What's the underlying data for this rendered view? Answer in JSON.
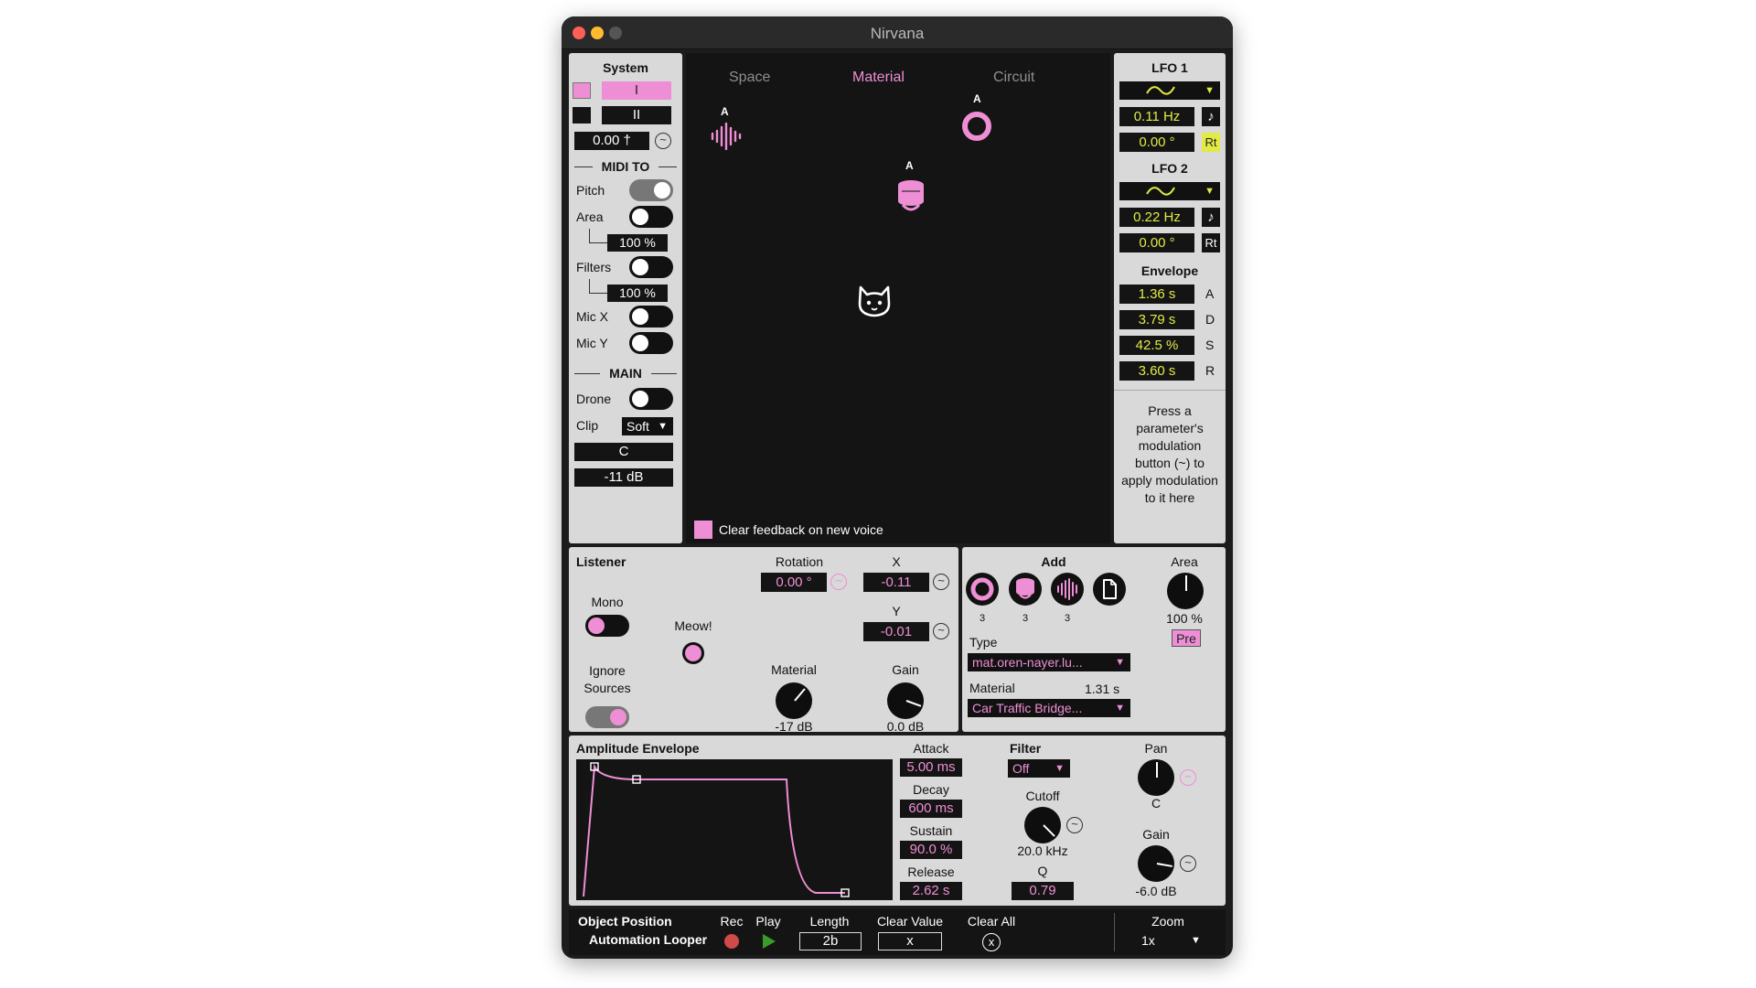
{
  "window": {
    "title": "Nirvana"
  },
  "system": {
    "title": "System",
    "play_symbol": "I",
    "pause_symbol": "II",
    "tempo_value": "0.00 †",
    "midi_to_heading": "MIDI TO",
    "pitch_label": "Pitch",
    "area_label": "Area",
    "area_value": "100 %",
    "filters_label": "Filters",
    "filters_value": "100 %",
    "mic_x_label": "Mic X",
    "mic_y_label": "Mic Y",
    "main_heading": "MAIN",
    "drone_label": "Drone",
    "clip_label": "Clip",
    "clip_value": "Soft",
    "key_value": "C",
    "level_value": "-11 dB"
  },
  "space": {
    "tabs": [
      "Space",
      "Material",
      "Circuit"
    ],
    "active_tab": "Material",
    "objects": [
      {
        "name": "waveform-source",
        "label": "A"
      },
      {
        "name": "ring-source",
        "label": "A"
      },
      {
        "name": "bell-source",
        "label": "A"
      }
    ],
    "clear_feedback_label": "Clear feedback on new voice"
  },
  "lfo1": {
    "title": "LFO 1",
    "rate": "0.11 Hz",
    "phase": "0.00 °",
    "sync_symbol": "♪",
    "rt_label": "Rt"
  },
  "lfo2": {
    "title": "LFO 2",
    "rate": "0.22 Hz",
    "phase": "0.00 °",
    "sync_symbol": "♪",
    "rt_label": "Rt"
  },
  "envelope": {
    "title": "Envelope",
    "rows": [
      {
        "value": "1.36 s",
        "letter": "A"
      },
      {
        "value": "3.79 s",
        "letter": "D"
      },
      {
        "value": "42.5 %",
        "letter": "S"
      },
      {
        "value": "3.60 s",
        "letter": "R"
      }
    ]
  },
  "help_text": "Press a parameter's modulation button (~) to apply modulation to it here",
  "listener": {
    "title": "Listener",
    "mono_label": "Mono",
    "meow_label": "Meow!",
    "ignore_sources_label": "Ignore Sources",
    "rotation_label": "Rotation",
    "rotation_value": "0.00 °",
    "x_label": "X",
    "x_value": "-0.11",
    "y_label": "Y",
    "y_value": "-0.01",
    "material_label": "Material",
    "material_value": "-17 dB",
    "gain_label": "Gain",
    "gain_value": "0.0 dB"
  },
  "add": {
    "title": "Add",
    "counts": [
      "3",
      "3",
      "3"
    ],
    "area_label": "Area",
    "area_value": "100 %",
    "pre_label": "Pre",
    "type_label": "Type",
    "type_value": "mat.oren-nayer.lu...",
    "material_label": "Material",
    "material_time": "1.31 s",
    "material_value": "Car Traffic Bridge..."
  },
  "amp_env": {
    "title": "Amplitude Envelope",
    "attack_label": "Attack",
    "attack_value": "5.00 ms",
    "decay_label": "Decay",
    "decay_value": "600 ms",
    "sustain_label": "Sustain",
    "sustain_value": "90.0 %",
    "release_label": "Release",
    "release_value": "2.62 s",
    "filter_label": "Filter",
    "filter_value": "Off",
    "cutoff_label": "Cutoff",
    "cutoff_value": "20.0 kHz",
    "q_label": "Q",
    "q_value": "0.79",
    "pan_label": "Pan",
    "pan_value": "C",
    "gain_label": "Gain",
    "gain_value": "-6.0 dB"
  },
  "looper": {
    "title_line1": "Object Position",
    "title_line2": "Automation Looper",
    "rec_label": "Rec",
    "play_label": "Play",
    "length_label": "Length",
    "length_value": "2b",
    "clear_value_label": "Clear Value",
    "clear_value_btn": "x",
    "clear_all_label": "Clear All",
    "zoom_label": "Zoom",
    "zoom_value": "1x"
  },
  "colors": {
    "accent_pink": "#ee8ed4",
    "lcd_yellow": "#e2ea45",
    "panel_grey": "#d9d9d9",
    "dark": "#141414"
  }
}
